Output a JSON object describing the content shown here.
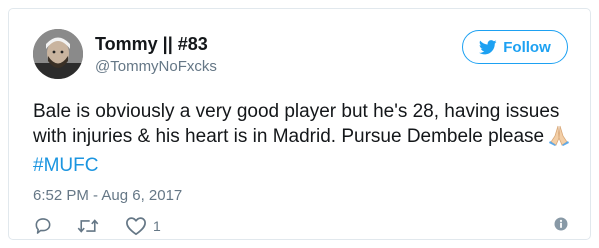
{
  "tweet": {
    "user": {
      "display_name": "Tommy || #83",
      "handle": "@TommyNoFxcks",
      "avatar_icon": "user-avatar"
    },
    "follow_button": {
      "label": "Follow",
      "icon": "twitter-bird-icon",
      "color": "#1da1f2"
    },
    "text_line_1": "Bale is obviously a very good player but he's 28, having issues",
    "text_line_2": "with injuries & his heart is in Madrid. Pursue Dembele please",
    "emoji": "folded-hands-emoji",
    "hashtag": "#MUFC",
    "timestamp": "6:52 PM - Aug 6, 2017",
    "actions": {
      "reply_icon": "reply-icon",
      "retweet_icon": "retweet-icon",
      "like_icon": "heart-icon",
      "like_count": "1",
      "info_icon": "info-icon"
    },
    "colors": {
      "text": "#14171a",
      "secondary": "#657786",
      "link": "#1b95e0"
    }
  }
}
